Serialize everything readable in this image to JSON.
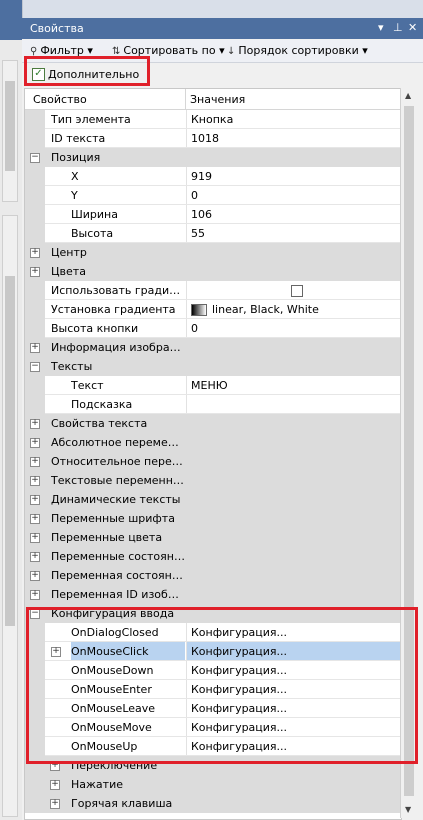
{
  "panel": {
    "title": "Свойства",
    "controls": [
      "▾",
      "⊥",
      "✕"
    ]
  },
  "toolbar": {
    "filter": "Фильтр",
    "sort_by": "Сортировать по",
    "sort_order": "Порядок сортировки"
  },
  "advanced": {
    "label": "Дополнительно",
    "checked": true
  },
  "grid": {
    "col_property": "Свойство",
    "col_values": "Значения",
    "rows": [
      {
        "name": "Тип элемента",
        "value": "Кнопка",
        "level": 1
      },
      {
        "name": "ID текста",
        "value": "1018",
        "level": 1
      },
      {
        "name": "Позиция",
        "value": "",
        "level": 0,
        "cat": true,
        "exp": "−"
      },
      {
        "name": "X",
        "value": "919",
        "level": 2
      },
      {
        "name": "Y",
        "value": "0",
        "level": 2
      },
      {
        "name": "Ширина",
        "value": "106",
        "level": 2
      },
      {
        "name": "Высота",
        "value": "55",
        "level": 2
      },
      {
        "name": "Центр",
        "value": "",
        "level": 0,
        "cat": true,
        "exp": "+"
      },
      {
        "name": "Цвета",
        "value": "",
        "level": 0,
        "cat": true,
        "exp": "+"
      },
      {
        "name": "Использовать градиен...",
        "value": "",
        "level": 1,
        "checkbox": true
      },
      {
        "name": "Установка градиента",
        "value": "linear, Black, White",
        "level": 1,
        "grad": true
      },
      {
        "name": "Высота кнопки",
        "value": "0",
        "level": 1
      },
      {
        "name": "Информация изображен...",
        "value": "",
        "level": 0,
        "cat": true,
        "exp": "+"
      },
      {
        "name": "Тексты",
        "value": "",
        "level": 0,
        "cat": true,
        "exp": "−"
      },
      {
        "name": "Текст",
        "value": "МЕНЮ",
        "level": 2
      },
      {
        "name": "Подсказка",
        "value": "",
        "level": 2
      },
      {
        "name": "Свойства текста",
        "value": "",
        "level": 0,
        "cat": true,
        "exp": "+"
      },
      {
        "name": "Абсолютное перемещен...",
        "value": "",
        "level": 0,
        "cat": true,
        "exp": "+"
      },
      {
        "name": "Относительное переме...",
        "value": "",
        "level": 0,
        "cat": true,
        "exp": "+"
      },
      {
        "name": "Текстовые переменные",
        "value": "",
        "level": 0,
        "cat": true,
        "exp": "+"
      },
      {
        "name": "Динамические тексты",
        "value": "",
        "level": 0,
        "cat": true,
        "exp": "+"
      },
      {
        "name": "Переменные шрифта",
        "value": "",
        "level": 0,
        "cat": true,
        "exp": "+"
      },
      {
        "name": "Переменные цвета",
        "value": "",
        "level": 0,
        "cat": true,
        "exp": "+"
      },
      {
        "name": "Переменные состояний",
        "value": "",
        "level": 0,
        "cat": true,
        "exp": "+"
      },
      {
        "name": "Переменная состояния...",
        "value": "",
        "level": 0,
        "cat": true,
        "exp": "+"
      },
      {
        "name": "Переменная ID изображ...",
        "value": "",
        "level": 0,
        "cat": true,
        "exp": "+"
      },
      {
        "name": "Конфигурация ввода",
        "value": "",
        "level": 0,
        "cat": true,
        "exp": "−"
      },
      {
        "name": "OnDialogClosed",
        "value": "Конфигурация...",
        "level": 2
      },
      {
        "name": "OnMouseClick",
        "value": "Конфигурация...",
        "level": 2,
        "exp": "+",
        "sel": true
      },
      {
        "name": "OnMouseDown",
        "value": "Конфигурация...",
        "level": 2
      },
      {
        "name": "OnMouseEnter",
        "value": "Конфигурация...",
        "level": 2
      },
      {
        "name": "OnMouseLeave",
        "value": "Конфигурация...",
        "level": 2
      },
      {
        "name": "OnMouseMove",
        "value": "Конфигурация...",
        "level": 2
      },
      {
        "name": "OnMouseUp",
        "value": "Конфигурация...",
        "level": 2
      },
      {
        "name": "Переключение",
        "value": "",
        "level": 1,
        "cat": true,
        "exp": "+"
      },
      {
        "name": "Нажатие",
        "value": "",
        "level": 1,
        "cat": true,
        "exp": "+"
      },
      {
        "name": "Горячая клавиша",
        "value": "",
        "level": 1,
        "cat": true,
        "exp": "+"
      }
    ]
  },
  "colors": {
    "title_bar": "#4d6fa0",
    "highlight": "#e0202a",
    "selection": "#b9d3f0"
  }
}
